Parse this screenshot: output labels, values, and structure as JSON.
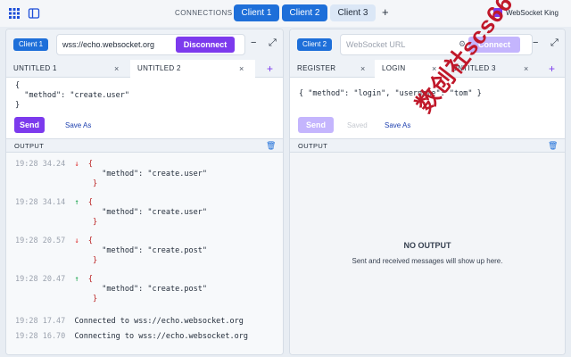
{
  "topbar": {
    "connections_label": "CONNECTIONS",
    "client_tabs": [
      "Client 1",
      "Client 2",
      "Client 3"
    ],
    "add_icon": "+",
    "brand": "WebSocket King",
    "grid_icon": "grid-icon",
    "sidebar_icon": "sidebar-toggle-icon"
  },
  "client1": {
    "badge": "Client 1",
    "url": "wss://echo.websocket.org",
    "connect_button": "Disconnect",
    "tabs": [
      "UNTITLED 1",
      "UNTITLED 2"
    ],
    "editor_lines": [
      "{",
      "  \"method\": \"create.user\"",
      "}"
    ],
    "send_label": "Send",
    "saveas_label": "Save As",
    "output_label": "OUTPUT",
    "messages": [
      {
        "time": "19:28 34.24",
        "dir": "in",
        "body": "\"method\": \"create.user\""
      },
      {
        "time": "19:28 34.14",
        "dir": "out",
        "body": "\"method\": \"create.user\""
      },
      {
        "time": "19:28 20.57",
        "dir": "in",
        "body": "\"method\": \"create.post\""
      },
      {
        "time": "19:28 20.47",
        "dir": "out",
        "body": "\"method\": \"create.post\""
      }
    ],
    "status_lines": [
      {
        "time": "19:28 17.47",
        "text": "Connected to wss://echo.websocket.org"
      },
      {
        "time": "19:28 16.70",
        "text": "Connecting to wss://echo.websocket.org"
      }
    ]
  },
  "client2": {
    "badge": "Client 2",
    "url_placeholder": "WebSocket URL",
    "connect_button": "Connect",
    "tabs": [
      "REGISTER",
      "LOGIN",
      "UNTITLED 3"
    ],
    "editor_line": "{ \"method\": \"login\", \"username\": \"tom\" }",
    "send_label": "Send",
    "saved_label": "Saved",
    "saveas_label": "Save As",
    "output_label": "OUTPUT",
    "empty_title": "NO OUTPUT",
    "empty_sub": "Sent and received messages will show up here."
  },
  "watermark": "数创社scs66",
  "colors": {
    "accent": "#1e6fd9",
    "purple": "#7c3aed",
    "incoming": "#dc2626",
    "outgoing": "#16a34a"
  }
}
